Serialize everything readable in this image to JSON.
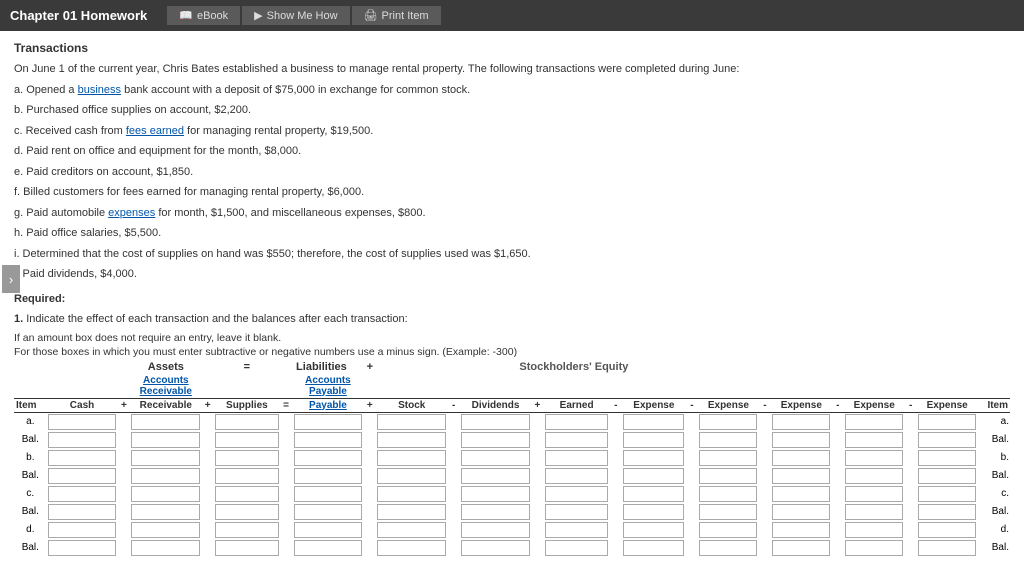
{
  "titleBar": {
    "title": "Chapter 01 Homework",
    "nav": [
      {
        "label": "eBook",
        "icon": "📖"
      },
      {
        "label": "Show Me How",
        "icon": "🎬"
      },
      {
        "label": "Print Item",
        "icon": "🖨️"
      }
    ]
  },
  "section": "Transactions",
  "intro": "On June 1 of the current year, Chris Bates established a business to manage rental property. The following transactions were completed during June:",
  "transactions": [
    {
      "id": "a",
      "text": "Opened a business bank account with a deposit of $75,000 in exchange for common stock.",
      "links": [
        "business"
      ]
    },
    {
      "id": "b",
      "text": "Purchased office supplies on account, $2,200."
    },
    {
      "id": "c",
      "text": "Received cash from fees earned for managing rental property, $19,500.",
      "links": [
        "fees earned"
      ]
    },
    {
      "id": "d",
      "text": "Paid rent on office and equipment for the month, $8,000."
    },
    {
      "id": "e",
      "text": "Paid creditors on account, $1,850."
    },
    {
      "id": "f",
      "text": "Billed customers for fees earned for managing rental property, $6,000."
    },
    {
      "id": "g",
      "text": "Paid automobile expenses for month, $1,500, and miscellaneous expenses, $800.",
      "links": [
        "expenses"
      ]
    },
    {
      "id": "h",
      "text": "Paid office salaries, $5,500."
    },
    {
      "id": "i",
      "text": "Determined that the cost of supplies on hand was $550; therefore, the cost of supplies used was $1,650."
    },
    {
      "id": "j",
      "text": "Paid dividends, $4,000."
    }
  ],
  "required": "Required:",
  "question1": {
    "number": "1.",
    "bold": "Indicate the effect of each transaction and the balances after each transaction:",
    "instructions": [
      "If an amount box does not require an entry, leave it blank.",
      "For those boxes in which you must enter subtractive or negative numbers use a minus sign. (Example: -300)"
    ]
  },
  "table": {
    "sections": {
      "assets": "Assets",
      "liabilities": "Liabilities",
      "equity": "Stockholders' Equity"
    },
    "operators": {
      "eq": "=",
      "plus1": "+",
      "plus2": "+",
      "plus3": "+",
      "plus4": "+",
      "minus1": "-",
      "minus2": "-",
      "minus3": "-",
      "minus4": "-",
      "minus5": "-"
    },
    "columns": {
      "item": "Item",
      "cash": "Cash",
      "accountsReceivable": "Accounts Receivable",
      "supplies": "Supplies",
      "accountsPayable": "Accounts Payable",
      "commonStock": "Common Stock",
      "dividends": "Dividends",
      "feesEarned": "Fees Earned",
      "rentExpense": "Rent Expense",
      "salExpense": "Sal. Expense",
      "suppExpense": "Supp. Expense",
      "autoExpense": "Auto Expense",
      "miscExpense": "Misc. Expense",
      "itemRight": "Item"
    },
    "subHeaders": {
      "accountsReceivable": "Accounts Receivable",
      "accountsPayable": "Accounts Payable"
    },
    "rows": [
      {
        "id": "a",
        "label": "a.",
        "isBalance": false
      },
      {
        "id": "bal1",
        "label": "Bal.",
        "isBalance": true
      },
      {
        "id": "b",
        "label": "b.",
        "isBalance": false
      },
      {
        "id": "bal2",
        "label": "Bal.",
        "isBalance": true
      },
      {
        "id": "c",
        "label": "c.",
        "isBalance": false
      },
      {
        "id": "bal3",
        "label": "Bal.",
        "isBalance": true
      },
      {
        "id": "d",
        "label": "d.",
        "isBalance": false
      },
      {
        "id": "bal4",
        "label": "Bal.",
        "isBalance": true
      }
    ]
  },
  "colors": {
    "headerBg": "#3a3a3a",
    "linkColor": "#0055aa",
    "tableBorder": "#aaa"
  }
}
